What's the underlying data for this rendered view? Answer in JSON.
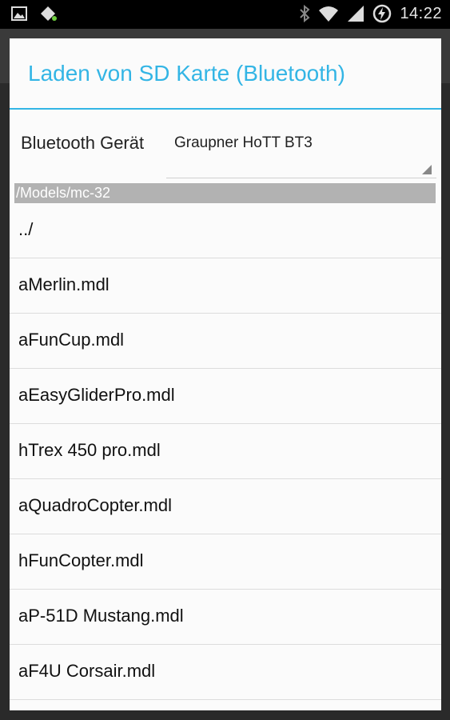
{
  "status_bar": {
    "time": "14:22",
    "icons_left": [
      "picture-icon",
      "android-debug-icon"
    ],
    "icons_right": [
      "bluetooth-icon",
      "wifi-icon",
      "signal-icon",
      "battery-charging-icon"
    ]
  },
  "dialog": {
    "title": "Laden von SD Karte (Bluetooth)",
    "device_label": "Bluetooth Gerät",
    "device_selected": "Graupner HoTT BT3",
    "path": "/Models/mc-32",
    "files": [
      "../",
      "aMerlin.mdl",
      "aFunCup.mdl",
      "aEasyGliderPro.mdl",
      "hTrex 450 pro.mdl",
      "aQuadroCopter.mdl",
      "hFunCopter.mdl",
      "aP-51D Mustang.mdl",
      "aF4U Corsair.mdl"
    ]
  },
  "colors": {
    "accent": "#33b5e5",
    "path_bar": "#b2b2b2"
  }
}
